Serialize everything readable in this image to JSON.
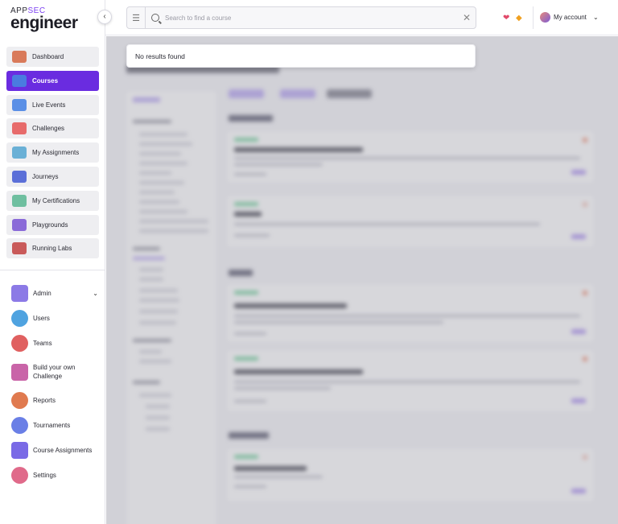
{
  "logo": {
    "top_prefix": "APP",
    "top_accent": "SEC",
    "bottom": "engineer"
  },
  "sidebar": {
    "items": [
      {
        "label": "Dashboard",
        "icon": "dashboard-icon",
        "color": "#d97a5a"
      },
      {
        "label": "Courses",
        "icon": "courses-icon",
        "color": "#4a7be0"
      },
      {
        "label": "Live Events",
        "icon": "live-events-icon",
        "color": "#5a8fe6"
      },
      {
        "label": "Challenges",
        "icon": "challenges-icon",
        "color": "#e76b6b"
      },
      {
        "label": "My Assignments",
        "icon": "assignments-icon",
        "color": "#6ab0d6"
      },
      {
        "label": "Journeys",
        "icon": "journeys-icon",
        "color": "#5b6fd8"
      },
      {
        "label": "My Certifications",
        "icon": "certifications-icon",
        "color": "#6fbfa0"
      },
      {
        "label": "Playgrounds",
        "icon": "playgrounds-icon",
        "color": "#8a6ad8"
      },
      {
        "label": "Running Labs",
        "icon": "running-labs-icon",
        "color": "#c95a5a"
      }
    ],
    "active_index": 1,
    "admin": [
      {
        "label": "Admin",
        "icon": "admin-icon",
        "color": "#8c7ae6"
      },
      {
        "label": "Users",
        "icon": "users-icon",
        "color": "#4fa3e0"
      },
      {
        "label": "Teams",
        "icon": "teams-icon",
        "color": "#e06060"
      },
      {
        "label": "Build your own Challenge",
        "icon": "build-challenge-icon",
        "color": "#c964a8"
      },
      {
        "label": "Reports",
        "icon": "reports-icon",
        "color": "#e07a4f"
      },
      {
        "label": "Tournaments",
        "icon": "tournaments-icon",
        "color": "#6a7fe6"
      },
      {
        "label": "Course Assignments",
        "icon": "course-assignments-icon",
        "color": "#7a6ae6"
      },
      {
        "label": "Settings",
        "icon": "settings-icon",
        "color": "#e06a8a"
      }
    ]
  },
  "header": {
    "search_placeholder": "Search to find a course",
    "account_label": "My account"
  },
  "search_dropdown": {
    "message": "No results found"
  },
  "colors": {
    "accent": "#6a2ce0",
    "heart": "#e14a6a"
  }
}
